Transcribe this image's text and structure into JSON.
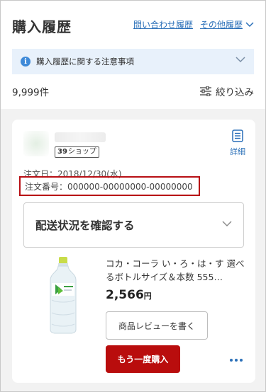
{
  "header": {
    "title": "購入履歴",
    "inquiry_link": "問い合わせ履歴",
    "other_link": "その他履歴"
  },
  "notice": {
    "text": "購入履歴に関する注意事項"
  },
  "summary": {
    "count": "9,999件",
    "filter_label": "絞り込み"
  },
  "order": {
    "shop_badge_num": "39",
    "shop_badge_text": "ショップ",
    "detail_label": "詳細",
    "date": "注文日：2018/12/30(水)",
    "number": "注文番号：000000-00000000-00000000",
    "shipping_status": "配送状況を確認する",
    "product_name": "コカ・コーラ い・ろ・は・す 選べるボトルサイズ＆本数 555…",
    "price": "2,566",
    "price_unit": "円",
    "review_button": "商品レビューを書く",
    "rebuy_button": "もう一度購入"
  },
  "colors": {
    "link": "#2a6fb8",
    "accent_red": "#b90d0d",
    "notice_bg": "#e8f1fb",
    "highlight_border": "#b80f14"
  },
  "icons": {
    "info": "info-icon",
    "chevron": "chevron-down-icon",
    "filter": "filter-sliders-icon",
    "detail": "document-icon",
    "more": "more-dots-icon"
  }
}
